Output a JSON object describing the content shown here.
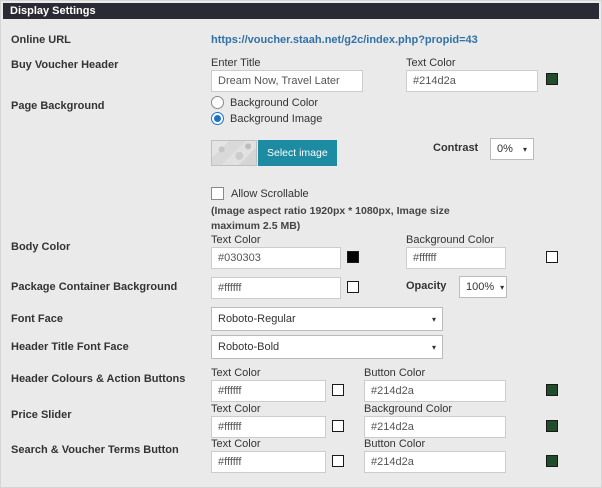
{
  "panel": {
    "title": "Display Settings"
  },
  "online_url": {
    "label": "Online URL",
    "link": "https://voucher.staah.net/g2c/index.php?propid=43"
  },
  "buy_voucher": {
    "label": "Buy Voucher Header",
    "enter_title_label": "Enter Title",
    "title_value": "Dream Now, Travel Later",
    "text_color_label": "Text Color",
    "text_color_value": "#214d2a"
  },
  "page_background": {
    "label": "Page Background",
    "option_color": "Background Color",
    "option_image": "Background Image",
    "selected_option": "Background Image",
    "select_image_button": "Select image",
    "contrast_label": "Contrast",
    "contrast_value": "0%"
  },
  "scrollable": {
    "label": "Allow Scrollable",
    "checked": false,
    "note": "(Image aspect ratio 1920px * 1080px, Image size maximum 2.5 MB)"
  },
  "body_color": {
    "label": "Body Color",
    "text_color_label": "Text Color",
    "text_color_value": "#030303",
    "background_color_label": "Background Color",
    "background_color_value": "#ffffff"
  },
  "package_container": {
    "label": "Package Container Background",
    "value": "#ffffff",
    "opacity_label": "Opacity",
    "opacity_value": "100%"
  },
  "font_face": {
    "label": "Font Face",
    "value": "Roboto-Regular"
  },
  "header_title_font_face": {
    "label": "Header Title Font Face",
    "value": "Roboto-Bold"
  },
  "header_colours": {
    "label": "Header Colours & Action Buttons",
    "text_color_label": "Text Color",
    "text_color_value": "#ffffff",
    "button_color_label": "Button Color",
    "button_color_value": "#214d2a"
  },
  "price_slider": {
    "label": "Price Slider",
    "text_color_label": "Text Color",
    "text_color_value": "#ffffff",
    "background_color_label": "Background Color",
    "background_color_value": "#214d2a"
  },
  "search_voucher": {
    "label": "Search & Voucher Terms Button",
    "text_color_label": "Text Color",
    "text_color_value": "#ffffff",
    "button_color_label": "Button Color",
    "button_color_value": "#214d2a"
  },
  "colors": {
    "titlebar_bg": "#2a2a34",
    "link_blue": "#3071a9",
    "teal_button": "#1d8ca3",
    "radio_blue": "#1a73c9",
    "swatch_green": "#214d2a"
  }
}
